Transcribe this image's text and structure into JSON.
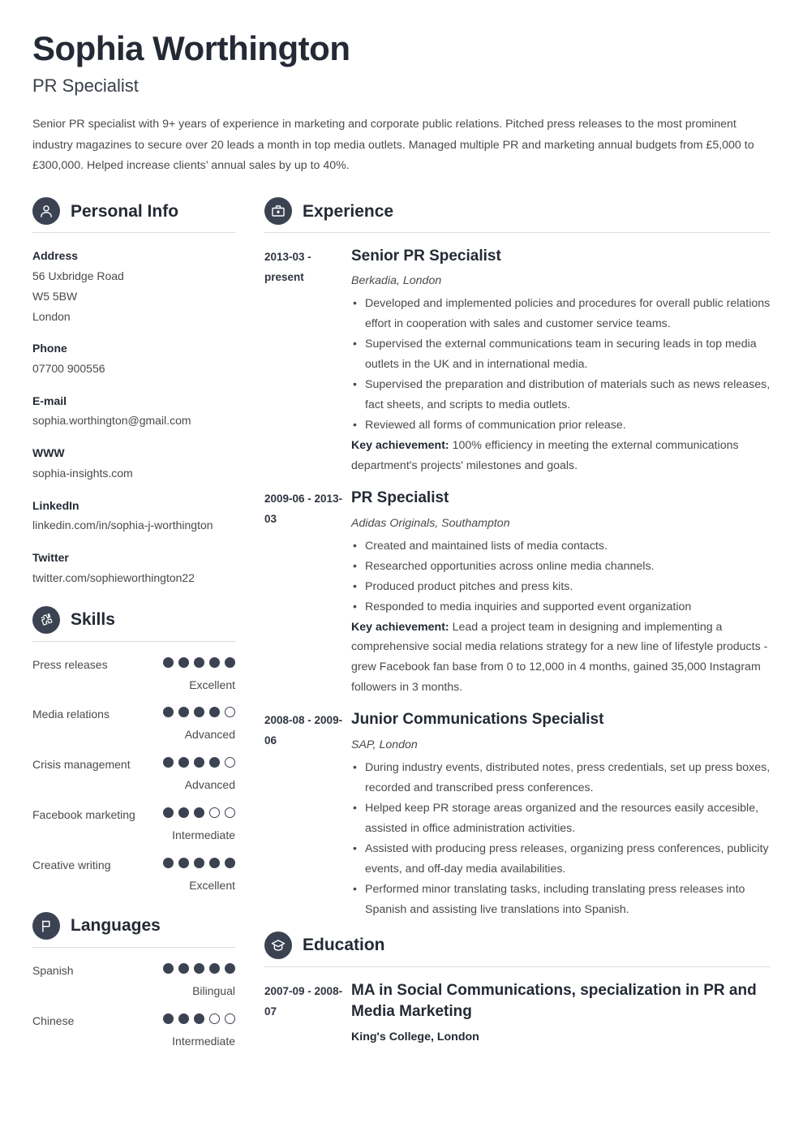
{
  "theme": {
    "accent": "#3b4352",
    "heading": "#242a35",
    "body": "#4a4a4a",
    "rule": "#dcdcdc"
  },
  "header": {
    "name": "Sophia Worthington",
    "job_title": "PR Specialist",
    "summary": "Senior PR specialist with 9+ years of experience in marketing and corporate public relations. Pitched press releases to the most prominent industry magazines to secure over 20 leads a month in top media outlets. Managed multiple PR and marketing annual budgets from £5,000 to £300,000. Helped increase clients’ annual sales by up to 40%."
  },
  "personal_info": {
    "title": "Personal Info",
    "icon": "person-icon",
    "blocks": [
      {
        "label": "Address",
        "lines": [
          "56 Uxbridge Road",
          "W5 5BW",
          "London"
        ]
      },
      {
        "label": "Phone",
        "lines": [
          "07700 900556"
        ]
      },
      {
        "label": "E-mail",
        "lines": [
          "sophia.worthington@gmail.com"
        ]
      },
      {
        "label": "WWW",
        "lines": [
          "sophia-insights.com"
        ]
      },
      {
        "label": "LinkedIn",
        "lines": [
          "linkedin.com/in/sophia-j-worthington"
        ]
      },
      {
        "label": "Twitter",
        "lines": [
          "twitter.com/sophieworthington22"
        ]
      }
    ]
  },
  "skills": {
    "title": "Skills",
    "icon": "puzzle-icon",
    "max": 5,
    "items": [
      {
        "name": "Press releases",
        "rating": 5,
        "level": "Excellent"
      },
      {
        "name": "Media relations",
        "rating": 4,
        "level": "Advanced"
      },
      {
        "name": "Crisis management",
        "rating": 4,
        "level": "Advanced"
      },
      {
        "name": "Facebook marketing",
        "rating": 3,
        "level": "Intermediate"
      },
      {
        "name": "Creative writing",
        "rating": 5,
        "level": "Excellent"
      }
    ]
  },
  "languages": {
    "title": "Languages",
    "icon": "flag-icon",
    "max": 5,
    "items": [
      {
        "name": "Spanish",
        "rating": 5,
        "level": "Bilingual"
      },
      {
        "name": "Chinese",
        "rating": 3,
        "level": "Intermediate"
      }
    ]
  },
  "experience": {
    "title": "Experience",
    "icon": "briefcase-icon",
    "entries": [
      {
        "dates": "2013-03 - present",
        "role": "Senior PR Specialist",
        "org": "Berkadia, London",
        "bullets": [
          "Developed and implemented policies and procedures for overall public relations effort in cooperation with sales and customer service teams.",
          "Supervised the external communications team in securing leads in top media outlets in the UK and in international media.",
          "Supervised the preparation and distribution of materials such as news releases, fact sheets, and scripts to media outlets.",
          "Reviewed all forms of communication prior release."
        ],
        "achievement_label": "Key achievement:",
        "achievement_text": "100% efficiency in meeting the external communications department's projects' milestones and goals."
      },
      {
        "dates": "2009-06 - 2013-03",
        "role": "PR Specialist",
        "org": "Adidas Originals, Southampton",
        "bullets": [
          "Created and maintained lists of media contacts.",
          "Researched opportunities across online media channels.",
          "Produced product pitches and press kits.",
          "Responded to media inquiries and supported event organization"
        ],
        "achievement_label": "Key achievement:",
        "achievement_text": "Lead a project team in designing and implementing a comprehensive social media relations strategy for a new line of lifestyle products - grew Facebook fan base from 0 to 12,000 in 4 months, gained 35,000 Instagram followers in 3 months."
      },
      {
        "dates": "2008-08 - 2009-06",
        "role": "Junior Communications Specialist",
        "org": "SAP, London",
        "bullets": [
          "During industry events, distributed notes, press credentials, set up press boxes, recorded and transcribed press conferences.",
          "Helped keep PR storage areas organized and the resources easily accesible, assisted in office administration activities.",
          "Assisted with producing press releases, organizing press conferences, publicity events, and off-day media availabilities.",
          "Performed minor translating tasks, including translating press releases into Spanish and assisting live translations into Spanish."
        ],
        "achievement_label": "",
        "achievement_text": ""
      }
    ]
  },
  "education": {
    "title": "Education",
    "icon": "graduation-cap-icon",
    "entries": [
      {
        "dates": "2007-09 - 2008-07",
        "degree": "MA in Social Communications, specialization in PR and Media Marketing",
        "school": "King's College, London"
      }
    ]
  }
}
